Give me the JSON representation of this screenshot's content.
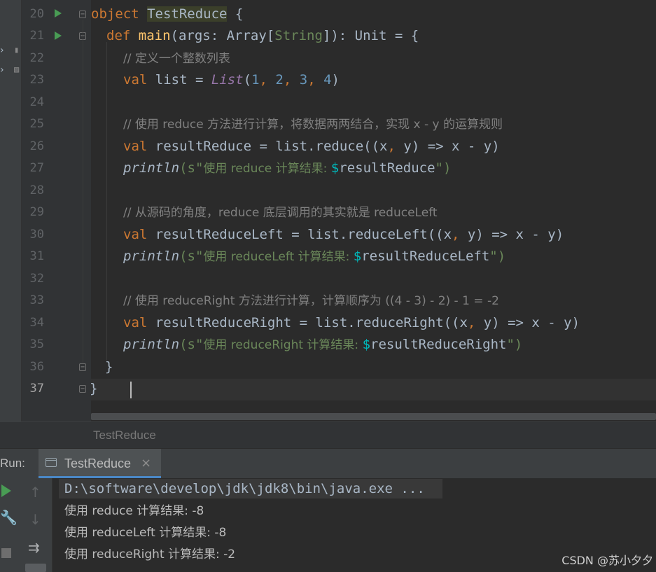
{
  "editor": {
    "line_numbers": [
      "20",
      "21",
      "22",
      "23",
      "24",
      "25",
      "26",
      "27",
      "28",
      "29",
      "30",
      "31",
      "32",
      "33",
      "34",
      "35",
      "36",
      "37"
    ],
    "lines": {
      "l20": {
        "kw": "object",
        "name": "TestReduce",
        "rest": " {"
      },
      "l21": {
        "kw": "def",
        "fn": "main",
        "p1": "(args: Array[",
        "ty": "String",
        "p2": "]): Unit = {"
      },
      "l22": {
        "comment": "// 定义一个整数列表"
      },
      "l23": {
        "kw": "val",
        "p1": " list = ",
        "list": "List",
        "p2": "(",
        "n1": "1",
        "c1": ", ",
        "n2": "2",
        "c2": ", ",
        "n3": "3",
        "c3": ", ",
        "n4": "4",
        "p3": ")"
      },
      "l25": {
        "comment": "// 使用 reduce 方法进行计算，将数据两两结合，实现 x - y 的运算规则"
      },
      "l26": {
        "kw": "val",
        "p1": " resultReduce = list.reduce((x",
        "c1": ", ",
        "p2": "y) => x - y)"
      },
      "l27": {
        "fn": "println",
        "p1": "(s\"",
        "str": "使用 reduce 计算结果: ",
        "dollar": "$",
        "var": "resultReduce",
        "p2": "\")"
      },
      "l29": {
        "comment": "// 从源码的角度，reduce 底层调用的其实就是 reduceLeft"
      },
      "l30": {
        "kw": "val",
        "p1": " resultReduceLeft = list.reduceLeft((x",
        "c1": ", ",
        "p2": "y) => x - y)"
      },
      "l31": {
        "fn": "println",
        "p1": "(s\"",
        "str": "使用 reduceLeft 计算结果: ",
        "dollar": "$",
        "var": "resultReduceLeft",
        "p2": "\")"
      },
      "l33": {
        "comment": "// 使用 reduceRight 方法进行计算，计算顺序为 ((4 - 3) - 2) - 1 = -2"
      },
      "l34": {
        "kw": "val",
        "p1": " resultReduceRight = list.reduceRight((x",
        "c1": ", ",
        "p2": "y) => x - y)"
      },
      "l35": {
        "fn": "println",
        "p1": "(s\"",
        "str": "使用 reduceRight 计算结果: ",
        "dollar": "$",
        "var": "resultReduceRight",
        "p2": "\")"
      },
      "l36": {
        "text": "}"
      },
      "l37": {
        "text": "}"
      }
    }
  },
  "breadcrumb": {
    "label": "TestReduce"
  },
  "run_panel": {
    "label": "Run:",
    "tab_name": "TestReduce",
    "tab_close": "×",
    "console": [
      "D:\\software\\develop\\jdk\\jdk8\\bin\\java.exe ...",
      "使用 reduce 计算结果: -8",
      "使用 reduceLeft 计算结果: -8",
      "使用 reduceRight 计算结果: -2"
    ]
  },
  "watermark": "CSDN @苏小夕夕",
  "colors": {
    "background": "#2b2b2b",
    "keyword": "#cc7832",
    "function": "#ffc66d",
    "number": "#6897bb",
    "string": "#6a8759",
    "comment": "#808080",
    "run_icon": "#499c54",
    "tab_underline": "#4a88c7"
  },
  "icons": [
    "run-gutter-icon",
    "fold-icon",
    "run-rerun-icon",
    "wrench-icon",
    "stop-icon",
    "arrow-up-icon",
    "arrow-down-icon",
    "soft-wrap-icon",
    "console-tab-icon",
    "close-icon"
  ]
}
